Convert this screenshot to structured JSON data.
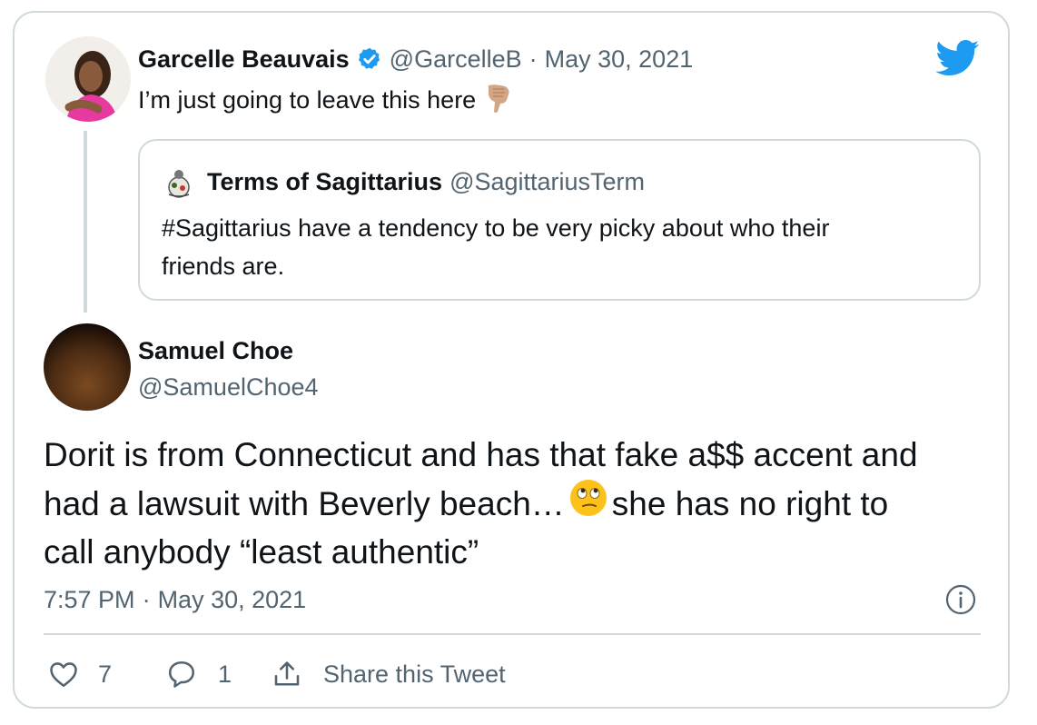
{
  "parent_tweet": {
    "author_name": "Garcelle Beauvais",
    "verified_icon": "verified-badge-icon",
    "handle": "@GarcelleB",
    "separator": "·",
    "date": "May 30, 2021",
    "text": "I’m just going to leave this here",
    "emoji": "backhand-index-pointing-down-icon"
  },
  "quoted_tweet": {
    "author_name": "Terms of Sagittarius",
    "handle": "@SagittariusTerm",
    "text_line1": "#Sagittarius have a tendency to be very picky about who their",
    "text_line2": "friends are."
  },
  "main_tweet": {
    "author_name": "Samuel Choe",
    "handle": "@SamuelChoe4",
    "text_line1": "Dorit is from Connecticut and has that fake a$$ accent and",
    "text_line2a": "had a lawsuit with Beverly beach…",
    "text_line2b": " she has no right to",
    "text_line3": "call anybody “least authentic”",
    "emoji": "face-with-rolling-eyes-icon",
    "time": "7:57 PM",
    "separator": "·",
    "date": "May 30, 2021"
  },
  "actions": {
    "like_count": "7",
    "reply_count": "1",
    "share_label": "Share this Tweet"
  },
  "colors": {
    "twitter_blue": "#1d9bf0",
    "muted_text": "#536471",
    "border": "#cfd9de"
  }
}
